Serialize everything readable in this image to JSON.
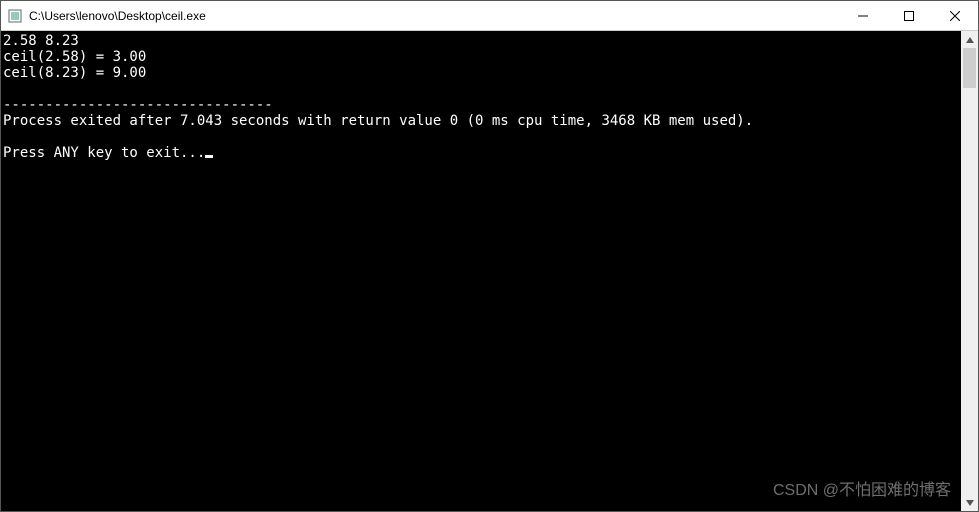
{
  "window": {
    "title": "C:\\Users\\lenovo\\Desktop\\ceil.exe"
  },
  "console": {
    "lines": [
      "2.58 8.23",
      "ceil(2.58) = 3.00",
      "ceil(8.23) = 9.00",
      "",
      "--------------------------------",
      "Process exited after 7.043 seconds with return value 0 (0 ms cpu time, 3468 KB mem used).",
      "",
      "Press ANY key to exit..."
    ]
  },
  "watermark": "CSDN @不怕困难的博客"
}
